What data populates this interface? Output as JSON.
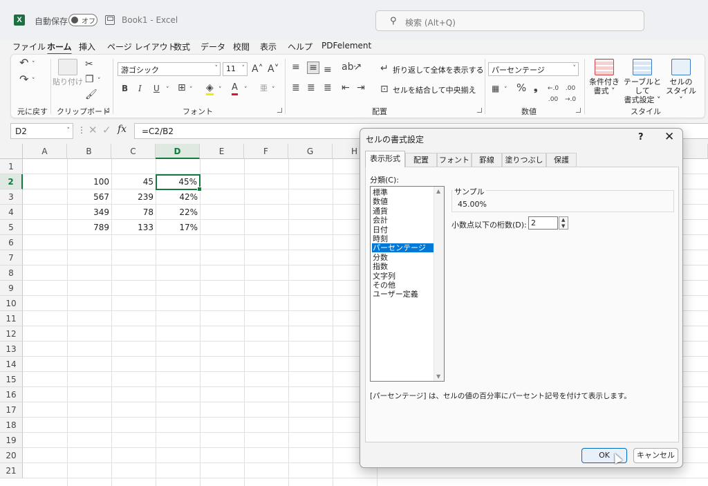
{
  "titlebar": {
    "autosave_label": "自動保存",
    "autosave_state": "オフ",
    "doc_title": "Book1  -  Excel",
    "search_placeholder": "検索 (Alt+Q)"
  },
  "menu_tabs": [
    "ファイル",
    "ホーム",
    "挿入",
    "ページ レイアウト",
    "数式",
    "データ",
    "校閲",
    "表示",
    "ヘルプ",
    "PDFelement"
  ],
  "active_tab": "ホーム",
  "ribbon": {
    "undo_label": "元に戻す",
    "clipboard": {
      "label": "クリップボード",
      "paste": "貼り付け"
    },
    "font": {
      "label": "フォント",
      "name": "游ゴシック",
      "size": "11"
    },
    "alignment": {
      "label": "配置",
      "wrap": "折り返して全体を表示する",
      "merge": "セルを結合して中央揃え"
    },
    "number": {
      "label": "数値",
      "format": "パーセンテージ"
    },
    "styles": {
      "label": "スタイル",
      "conditional": [
        "条件付き",
        "書式 ˅"
      ],
      "table": [
        "テーブルとして",
        "書式設定 ˅"
      ],
      "cell": [
        "セルの",
        "スタイル ˅"
      ]
    }
  },
  "formula_bar": {
    "name_box": "D2",
    "formula": "=C2/B2",
    "fx": "fx"
  },
  "sheet": {
    "columns": [
      "A",
      "B",
      "C",
      "D",
      "E",
      "F",
      "G",
      "H"
    ],
    "rows": [
      "1",
      "2",
      "3",
      "4",
      "5",
      "6",
      "7",
      "8",
      "9",
      "10",
      "11",
      "12",
      "13",
      "14",
      "15",
      "16",
      "17",
      "18",
      "19",
      "20",
      "21"
    ],
    "selected_column": "D",
    "selected_row": "2",
    "cells": [
      {
        "row": 2,
        "B": "100",
        "C": "45",
        "D": "45%"
      },
      {
        "row": 3,
        "B": "567",
        "C": "239",
        "D": "42%"
      },
      {
        "row": 4,
        "B": "349",
        "C": "78",
        "D": "22%"
      },
      {
        "row": 5,
        "B": "789",
        "C": "133",
        "D": "17%"
      }
    ]
  },
  "dialog": {
    "title": "セルの書式設定",
    "help": "?",
    "close": "✕",
    "tabs": [
      "表示形式",
      "配置",
      "フォント",
      "罫線",
      "塗りつぶし",
      "保護"
    ],
    "active_tab": "表示形式",
    "category_label": "分類(C):",
    "categories": [
      "標準",
      "数値",
      "通貨",
      "会計",
      "日付",
      "時刻",
      "パーセンテージ",
      "分数",
      "指数",
      "文字列",
      "その他",
      "ユーザー定義"
    ],
    "selected_category": "パーセンテージ",
    "sample_label": "サンプル",
    "sample_value": "45.00%",
    "decimal_label": "小数点以下の桁数(D):",
    "decimal_value": "2",
    "description": "[パーセンテージ] は、セルの値の百分率にパーセント記号を付けて表示します。",
    "ok_label": "OK",
    "cancel_label": "キャンセル"
  },
  "colors": {
    "accent_green": "#117a3e",
    "selection_blue": "#0078d7"
  }
}
